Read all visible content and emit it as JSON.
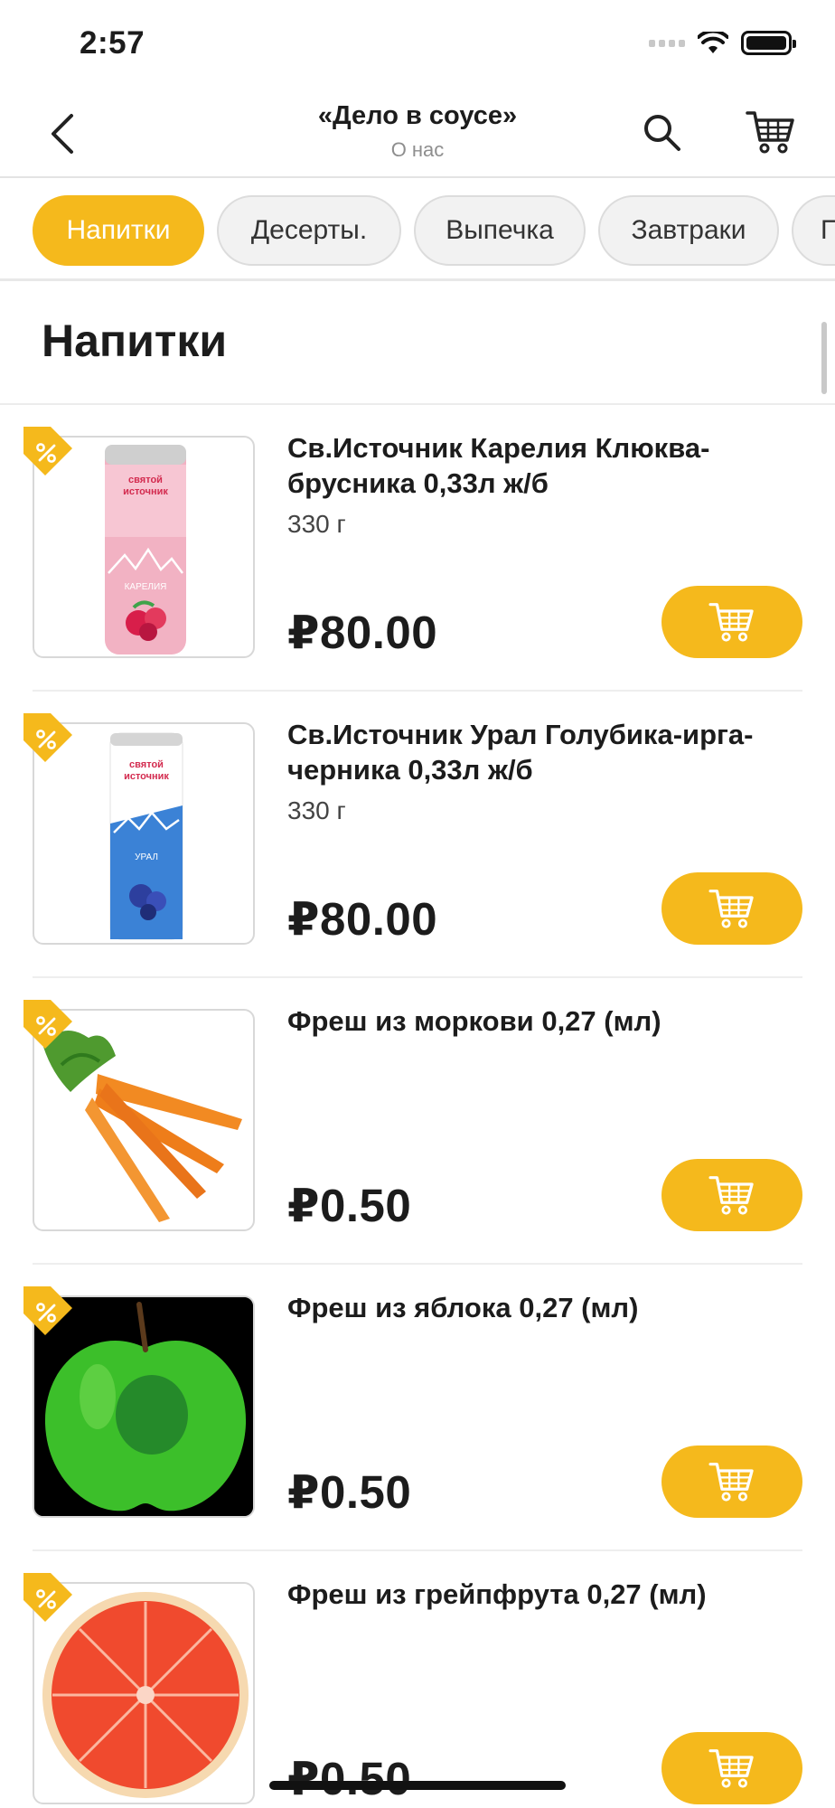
{
  "status_bar": {
    "time": "2:57"
  },
  "nav": {
    "title": "«Дело в соусе»",
    "subtitle": "О нас"
  },
  "categories": [
    {
      "label": "Напитки",
      "active": true
    },
    {
      "label": "Десерты."
    },
    {
      "label": "Выпечка"
    },
    {
      "label": "Завтраки"
    },
    {
      "label": "П"
    }
  ],
  "section": {
    "title": "Напитки"
  },
  "products": [
    {
      "name": "Св.Источник Карелия Клюква-брусника 0,33л ж/б",
      "weight": "330 г",
      "price": "₽80.00",
      "image": "pink-can",
      "can_label": "КАРЕЛИЯ"
    },
    {
      "name": "Св.Источник Урал Голубика-ирга-черника 0,33л ж/б",
      "weight": "330 г",
      "price": "₽80.00",
      "image": "blue-can",
      "can_label": "УРАЛ"
    },
    {
      "name": "Фреш из моркови 0,27 (мл)",
      "weight": "",
      "price": "₽0.50",
      "image": "carrots"
    },
    {
      "name": "Фреш из яблока 0,27 (мл)",
      "weight": "",
      "price": "₽0.50",
      "image": "green-apple"
    },
    {
      "name": "Фреш из грейпфрута 0,27 (мл)",
      "weight": "",
      "price": "₽0.50",
      "image": "grapefruit"
    }
  ],
  "colors": {
    "accent": "#f5b91c",
    "text": "#1c1c1c",
    "muted": "#8e8e8e"
  }
}
